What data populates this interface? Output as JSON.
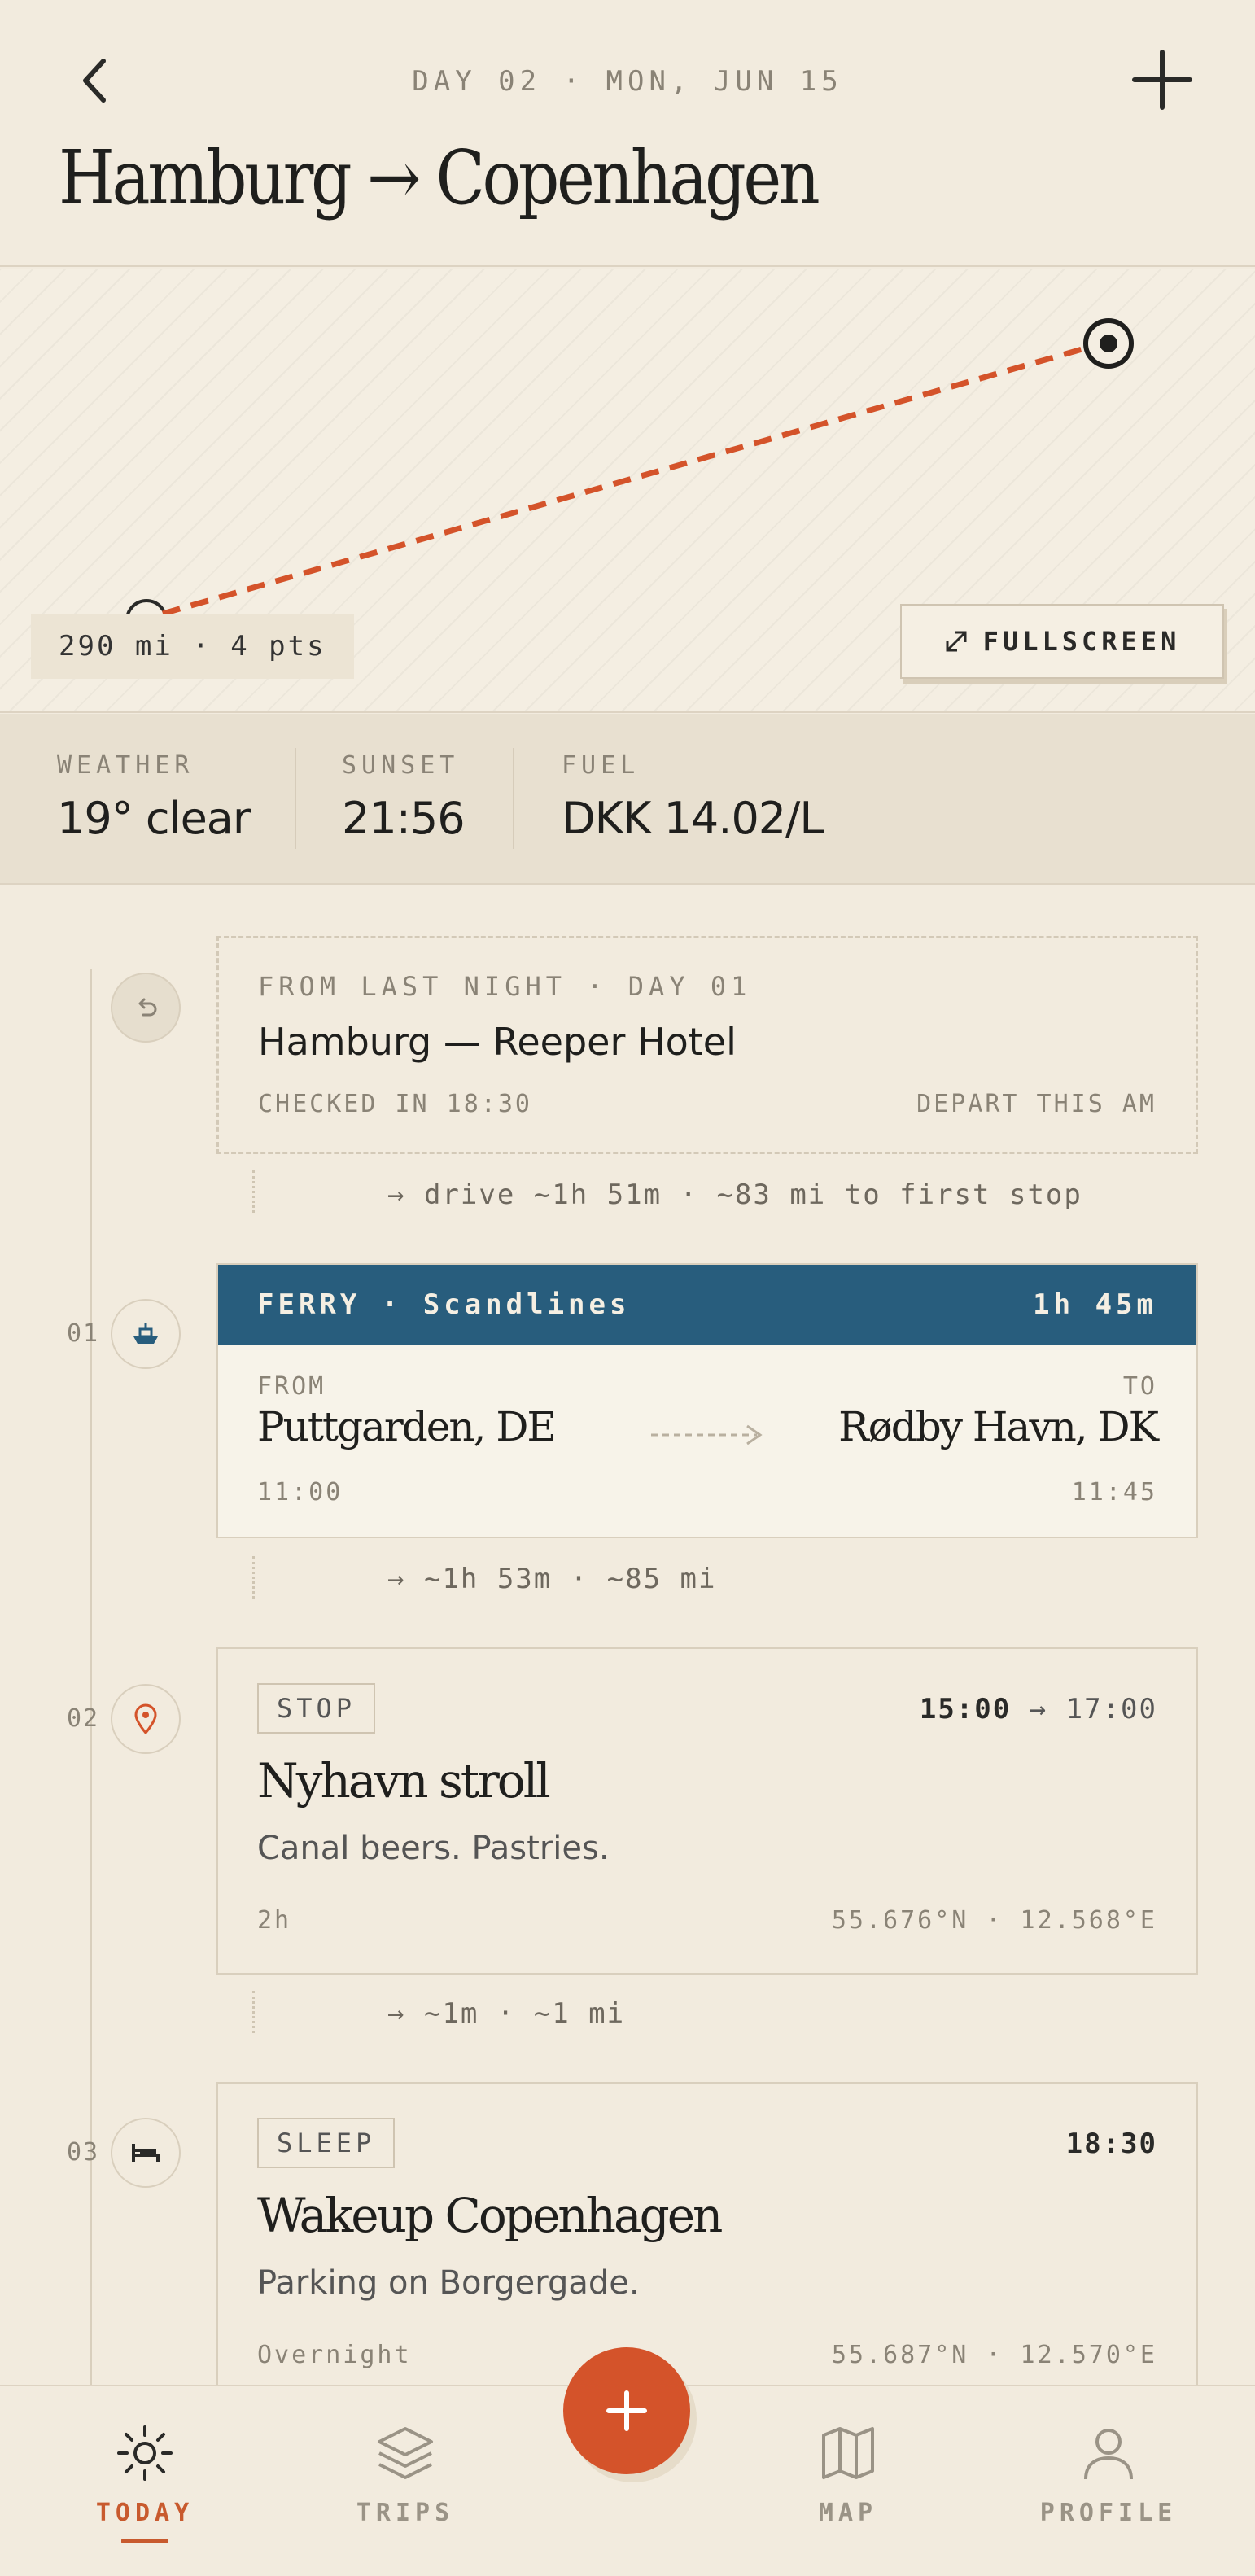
{
  "header": {
    "day_label": "DAY 02 · MON, JUN 15",
    "title": "Hamburg → Copenhagen"
  },
  "map": {
    "stats": "290 mi · 4 pts",
    "fullscreen_label": "FULLSCREEN"
  },
  "stats": [
    {
      "label": "WEATHER",
      "value": "19° clear"
    },
    {
      "label": "SUNSET",
      "value": "21:56"
    },
    {
      "label": "FUEL",
      "value": "DKK 14.02/L"
    }
  ],
  "timeline": {
    "origin": {
      "kicker": "FROM LAST NIGHT · DAY 01",
      "title": "Hamburg — Reeper Hotel",
      "left_note": "CHECKED IN 18:30",
      "right_note": "DEPART THIS AM"
    },
    "travel_1": "→ drive ~1h 51m · ~83 mi to first stop",
    "ferry": {
      "num": "01",
      "header": "FERRY · Scandlines",
      "duration": "1h 45m",
      "from_label": "FROM",
      "from_place": "Puttgarden, DE",
      "from_time": "11:00",
      "to_label": "TO",
      "to_place": "Rødby Havn, DK",
      "to_time": "11:45"
    },
    "travel_2": "→ ~1h 53m · ~85 mi",
    "stop": {
      "num": "02",
      "tag": "STOP",
      "time_start": "15:00",
      "time_end": "→ 17:00",
      "title": "Nyhavn stroll",
      "desc": "Canal beers. Pastries.",
      "duration": "2h",
      "coords": "55.676°N · 12.568°E"
    },
    "travel_3": "→ ~1m · ~1 mi",
    "sleep": {
      "num": "03",
      "tag": "SLEEP",
      "time": "18:30",
      "title": "Wakeup Copenhagen",
      "desc": "Parking on Borgergade.",
      "duration": "Overnight",
      "coords": "55.687°N · 12.570°E"
    }
  },
  "nav": {
    "items": [
      {
        "label": "TODAY",
        "icon": "sun-icon",
        "active": true
      },
      {
        "label": "TRIPS",
        "icon": "layers-icon"
      },
      {
        "label": "MAP",
        "icon": "map-icon"
      },
      {
        "label": "PROFILE",
        "icon": "user-icon"
      }
    ]
  },
  "colors": {
    "background": "#f2ebde",
    "accent": "#d4532a",
    "ferry": "#285d7d"
  }
}
